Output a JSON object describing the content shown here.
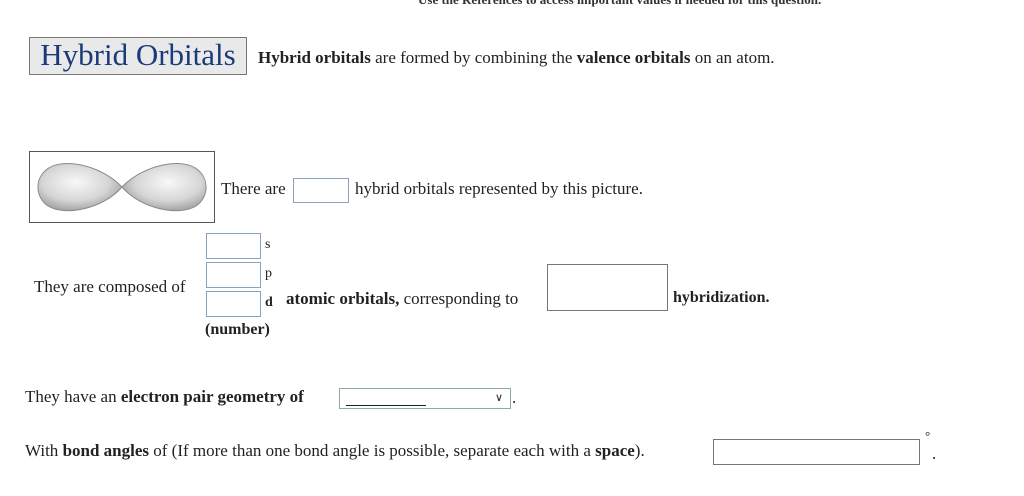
{
  "header": {
    "references_note": "Use the References to access important values if needed for this question."
  },
  "title": "Hybrid Orbitals",
  "intro": {
    "pre": "Hybrid orbitals",
    "mid": " are formed by combining the ",
    "bold": "valence orbitals",
    "post": " on an atom."
  },
  "picture": {
    "label_pre": "There are",
    "label_post": "hybrid orbitals represented by this picture."
  },
  "composition": {
    "label": "They are composed of",
    "s_label": "s",
    "p_label": "p",
    "d_label": "d",
    "number_label": "(number)",
    "atomic_text": "atomic orbitals,",
    "corresponding_text": " corresponding to",
    "hybridization_text": "hybridization."
  },
  "geometry": {
    "pre": "They have an ",
    "bold": "electron pair geometry of",
    "post": "."
  },
  "bond_angles": {
    "pre": "With ",
    "bold": "bond angles",
    "mid": " of (If more than one bond angle is possible, separate each with a ",
    "bold2": "space",
    "post": ").",
    "degree_symbol": "°",
    "period": "."
  },
  "icons": [
    "dropdown-chevron-icon",
    "orbital-lobes-image"
  ]
}
